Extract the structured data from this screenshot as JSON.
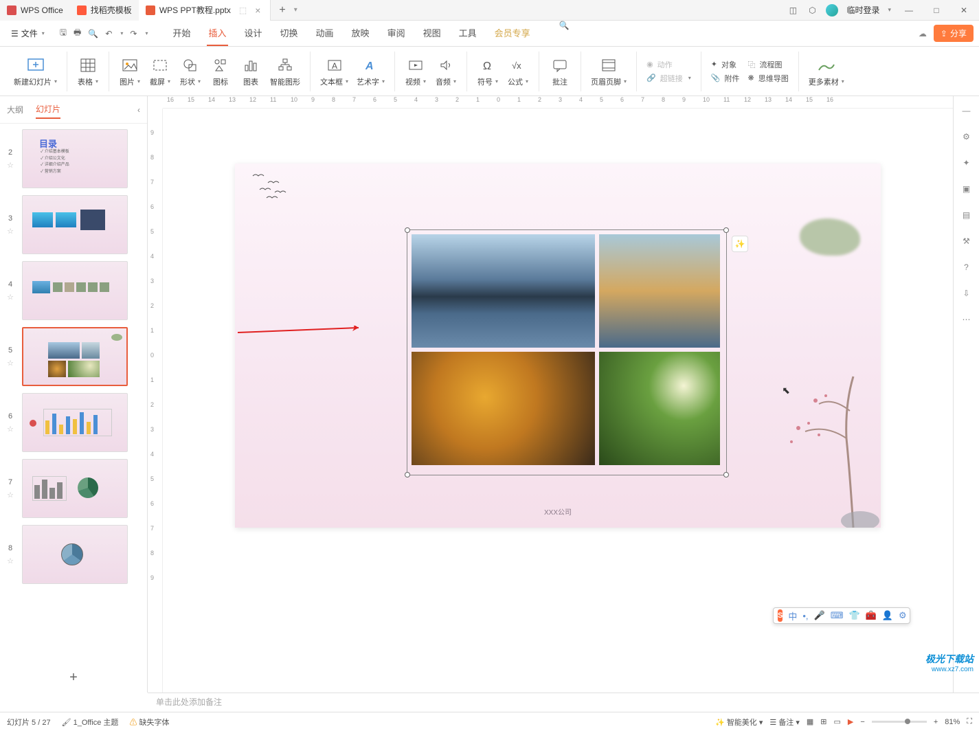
{
  "titlebar": {
    "tabs": [
      {
        "label": "WPS Office",
        "icon": "wps"
      },
      {
        "label": "找稻壳模板",
        "icon": "doc"
      },
      {
        "label": "WPS PPT教程.pptx",
        "icon": "ppt",
        "active": true
      }
    ],
    "login_label": "临时登录"
  },
  "menubar": {
    "file_label": "文件",
    "tabs": [
      "开始",
      "插入",
      "设计",
      "切换",
      "动画",
      "放映",
      "审阅",
      "视图",
      "工具",
      "会员专享"
    ],
    "active_tab": "插入",
    "member_tab": "会员专享",
    "share_label": "分享"
  },
  "ribbon": {
    "new_slide": "新建幻灯片",
    "groups": {
      "table": "表格",
      "picture": "图片",
      "screenshot": "截屏",
      "shape": "形状",
      "icon": "图标",
      "chart": "图表",
      "smart": "智能图形",
      "textbox": "文本框",
      "wordart": "艺术字",
      "video": "视频",
      "audio": "音频",
      "symbol": "符号",
      "equation": "公式",
      "comment": "批注",
      "headerfooter": "页眉页脚",
      "action": "动作",
      "hyperlink": "超链接",
      "object": "对象",
      "flowchart": "流程图",
      "attachment": "附件",
      "mindmap": "思维导图",
      "more": "更多素材"
    }
  },
  "panel": {
    "tabs": {
      "outline": "大纲",
      "slides": "幻灯片"
    },
    "active": "幻灯片",
    "thumbs": [
      2,
      3,
      4,
      5,
      6,
      7,
      8
    ],
    "selected": 5
  },
  "ruler": {
    "h": [
      "16",
      "15",
      "14",
      "13",
      "12",
      "11",
      "10",
      "9",
      "8",
      "7",
      "6",
      "5",
      "4",
      "3",
      "2",
      "1",
      "0",
      "1",
      "2",
      "3",
      "4",
      "5",
      "6",
      "7",
      "8",
      "9",
      "10",
      "11",
      "12",
      "13",
      "14",
      "15",
      "16"
    ],
    "v": [
      "9",
      "8",
      "7",
      "6",
      "5",
      "4",
      "3",
      "2",
      "1",
      "0",
      "1",
      "2",
      "3",
      "4",
      "5",
      "6",
      "7",
      "8",
      "9"
    ]
  },
  "slide": {
    "footer": "XXX公司",
    "toc_title": "目录",
    "toc_items": [
      "介绍基本模板",
      "介绍公文化",
      "详细介绍产品",
      "营销方案"
    ]
  },
  "notes": {
    "placeholder": "单击此处添加备注"
  },
  "statusbar": {
    "slide_info": "幻灯片 5 / 27",
    "theme": "1_Office 主题",
    "missing_font": "缺失字体",
    "smart_beautify": "智能美化",
    "notes_label": "备注",
    "zoom": "81%"
  },
  "ime": {
    "lang": "中"
  },
  "watermark": {
    "line1": "极光下载站",
    "line2": "www.xz7.com"
  }
}
